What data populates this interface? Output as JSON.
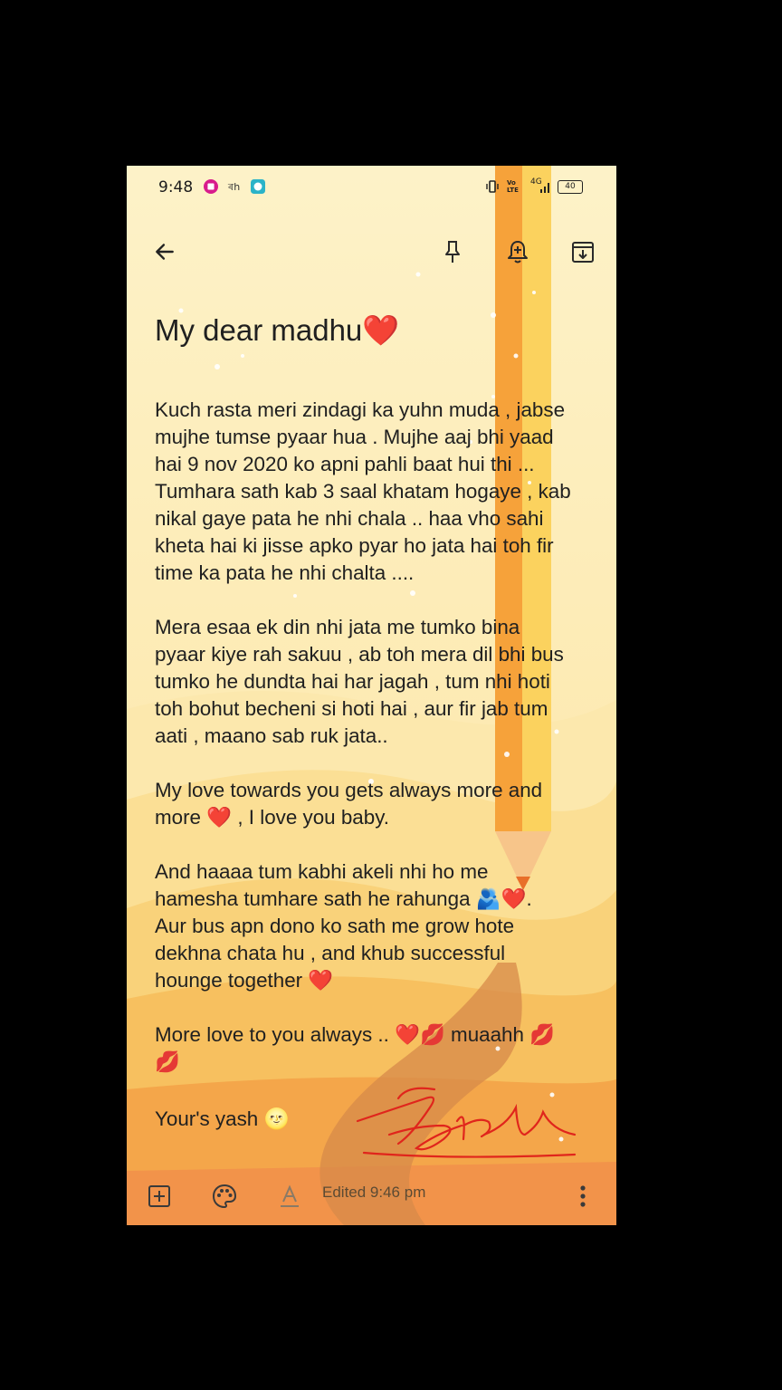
{
  "status_bar": {
    "time": "9:48",
    "network": "4G",
    "battery": "40",
    "volte": "Vo LTE"
  },
  "app_bar": {
    "icons": [
      "back-arrow-icon",
      "pin-icon",
      "reminder-bell-icon",
      "archive-icon"
    ]
  },
  "note": {
    "title": "My dear madhu❤️",
    "paragraphs": [
      [
        "Kuch rasta meri zindagi ka yuhn muda , jabse",
        "mujhe tumse pyaar hua . Mujhe aaj bhi yaad",
        "hai 9 nov 2020  ko apni pahli baat hui thi ...",
        "Tumhara sath kab 3 saal khatam hogaye , kab",
        "nikal gaye pata he nhi chala .. haa vho sahi",
        "kheta hai ki jisse apko pyar ho jata hai toh fir",
        "time ka pata he nhi chalta ...."
      ],
      [
        "Mera esaa ek din nhi jata me tumko bina",
        "pyaar kiye rah sakuu , ab toh mera dil bhi bus",
        "tumko he dundta hai har jagah , tum nhi hoti",
        "toh bohut becheni si hoti hai , aur fir jab tum",
        "aati , maano sab ruk jata.."
      ],
      [
        "My love towards you gets always more and",
        "more ❤️ , I love you baby."
      ],
      [
        "And haaaa tum kabhi akeli nhi ho me",
        "hamesha tumhare sath he rahunga 🫂❤️.",
        "Aur bus apn dono ko sath me grow hote",
        "dekhna chata hu , and khub successful",
        "hounge together ❤️"
      ],
      [
        "More love to you always .. ❤️💋 muaahh 💋",
        "💋"
      ],
      [
        "Your's   yash 🌝"
      ]
    ]
  },
  "bottom_bar": {
    "edited_text": "Edited 9:46 pm",
    "icons": [
      "add-box-icon",
      "palette-icon",
      "text-format-icon",
      "more-vert-icon"
    ]
  },
  "colors": {
    "background_top": "#fdf1c6",
    "background_bottom": "#f2934a",
    "pencil": "#f6a23a",
    "signature": "#e0251c"
  }
}
